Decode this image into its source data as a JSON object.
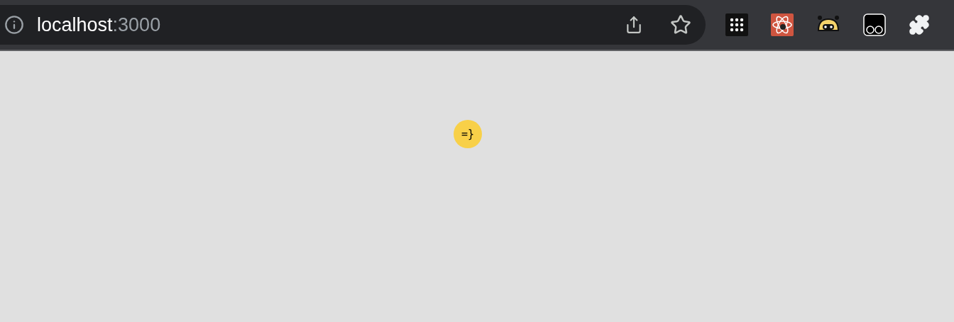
{
  "address_bar": {
    "host": "localhost",
    "port": ":3000"
  },
  "badge": {
    "text": "=}"
  }
}
